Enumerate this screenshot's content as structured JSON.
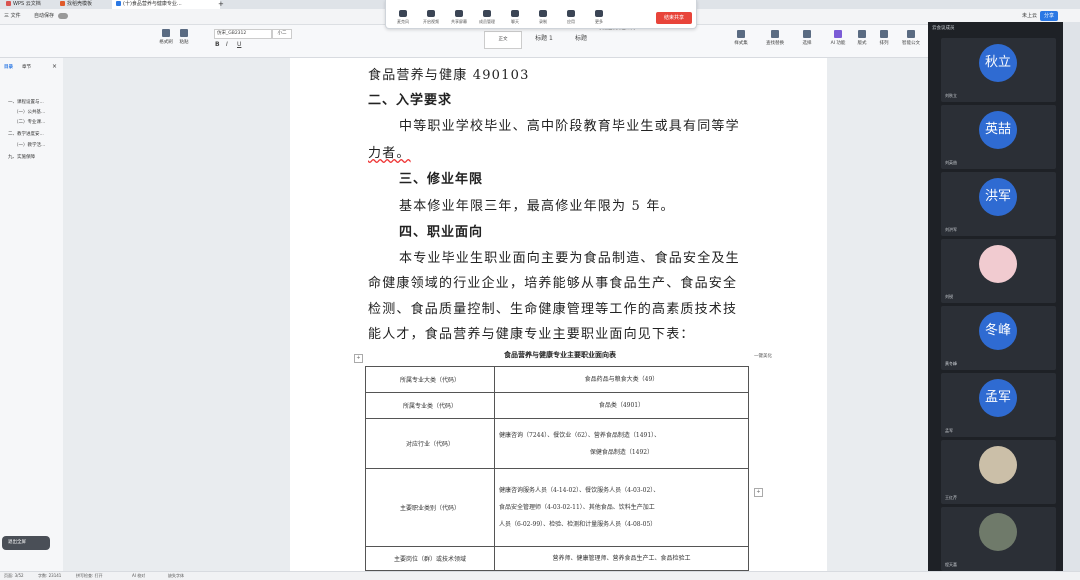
{
  "tabs": [
    {
      "label": "WPS 云文档",
      "color": "#d9534f"
    },
    {
      "label": "找稻壳模板",
      "color": "#e05a2a"
    },
    {
      "label": "(十)食品营养与健康专业...",
      "color": "#2b78e4"
    }
  ],
  "menu": {
    "file": "三 文件",
    "undo_group": "自动保存"
  },
  "ribbon": {
    "format_painter": "格式刷",
    "paste": "粘贴",
    "font_name": "仿宋_GB2312",
    "font_size": "小二",
    "style_body": "正文",
    "style_h1": "标题 1",
    "style_h2": "标题",
    "quick_format": "快速查找双击样式",
    "style_set": "样式集",
    "find_replace": "查找替换",
    "select": "选择",
    "ai": "AI 功能",
    "layout": "版式",
    "arrange": "排列",
    "smart": "智能公文"
  },
  "meeting": {
    "buttons": [
      "麦克风",
      "开启视频",
      "共享屏幕",
      "成员管理",
      "聊天",
      "录制",
      "应用",
      "更多"
    ],
    "end_label": "结束共享"
  },
  "nav": {
    "tab_outline": "目录",
    "tab_chapter": "章节",
    "items": [
      "一、课程设置与...",
      "（一）公共基...",
      "（二）专业课...",
      "二、教学进度安...",
      "（一）教学活...",
      "九、实施保障"
    ]
  },
  "doc": {
    "line1": "食品营养与健康 490103",
    "h_entry": "二、入学要求",
    "entry1": "中等职业学校毕业、高中阶段教育毕业生或具有同等学",
    "entry2": "力者。",
    "h_years": "三、修业年限",
    "years": "基本修业年限三年，最高修业年限为 5 年。",
    "h_career": "四、职业面向",
    "career1": "本专业毕业生职业面向主要为食品制造、食品安全及生",
    "career2": "命健康领域的行业企业，培养能够从事食品生产、食品安全",
    "career3": "检测、食品质量控制、生命健康管理等工作的高素质技术技",
    "career4": "能人才，食品营养与健康专业主要职业面向见下表：",
    "table_caption": "食品营养与健康专业主要职业面向表",
    "table": [
      {
        "k": "所属专业大类（代码）",
        "v": [
          "食品药品与粮食大类（49）"
        ]
      },
      {
        "k": "所属专业类（代码）",
        "v": [
          "食品类（4901）"
        ]
      },
      {
        "k": "对应行业（代码）",
        "v": [
          "健康咨询（7244）、餐饮业（62）、营养食品制造（1491）、",
          "保健食品制造（1492）"
        ]
      },
      {
        "k": "主要职业类别（代码）",
        "v": [
          "健康咨询服务人员（4-14-02）、餐饮服务人员（4-03-02）、",
          "食品安全管理师（4-03-02-11）、其他食品、饮料生产加工",
          "人员（6-02-99）、检验、检测和计量服务人员（4-08-05）"
        ]
      },
      {
        "k": "主要岗位（群）或技术领域",
        "v": [
          "营养师、健康管理师、营养食品生产工、食品检验工"
        ]
      }
    ],
    "float_hint": "一键美化"
  },
  "participants_header": "云会议成员",
  "participants": [
    {
      "avatar": "秋立",
      "name": "刘秋立",
      "type": "text"
    },
    {
      "avatar": "英喆",
      "name": "刘英喆",
      "type": "text"
    },
    {
      "avatar": "洪军",
      "name": "刘洪军",
      "type": "text"
    },
    {
      "avatar": "",
      "name": "刘锐",
      "type": "photo",
      "color": "#f1cbd0"
    },
    {
      "avatar": "冬峰",
      "name": "黄冬峰",
      "type": "text"
    },
    {
      "avatar": "孟军",
      "name": "孟军",
      "type": "text"
    },
    {
      "avatar": "",
      "name": "王红芹",
      "type": "photo",
      "color": "#cbbfa8"
    },
    {
      "avatar": "",
      "name": "程天喜",
      "type": "photo",
      "color": "#6f7a6a"
    }
  ],
  "top_right": {
    "share_label": "分享",
    "user": "未上云"
  },
  "status": {
    "page": "页面: 3/52",
    "words": "字数: 23141",
    "spell": "拼写检查: 打开",
    "ai": "AI 校对",
    "fonts": "缺失字体"
  },
  "toast": "退出全屏"
}
